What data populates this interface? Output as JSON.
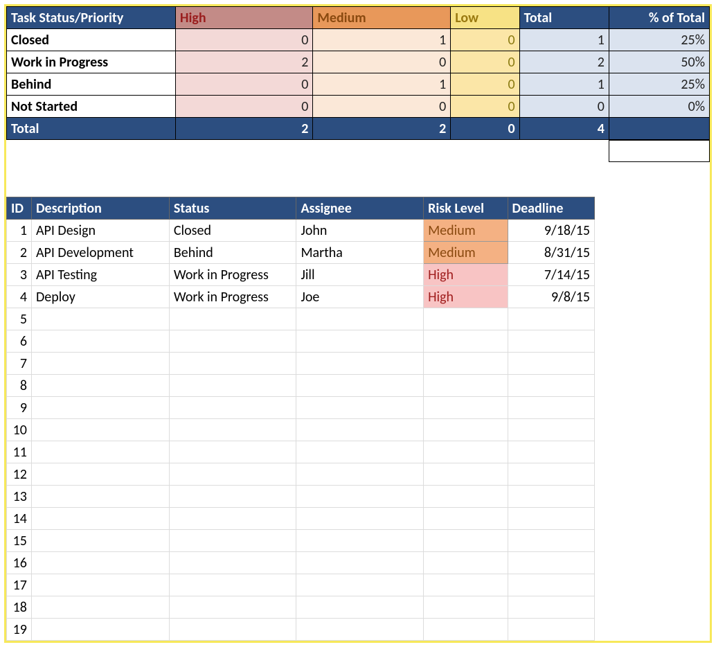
{
  "summary": {
    "headers": {
      "status": "Task Status/Priority",
      "high": "High",
      "medium": "Medium",
      "low": "Low",
      "total": "Total",
      "pct": "% of Total"
    },
    "rows": [
      {
        "status": "Closed",
        "high": "0",
        "medium": "1",
        "low": "0",
        "total": "1",
        "pct": "25%"
      },
      {
        "status": "Work in Progress",
        "high": "2",
        "medium": "0",
        "low": "0",
        "total": "2",
        "pct": "50%"
      },
      {
        "status": "Behind",
        "high": "0",
        "medium": "1",
        "low": "0",
        "total": "1",
        "pct": "25%"
      },
      {
        "status": "Not Started",
        "high": "0",
        "medium": "0",
        "low": "0",
        "total": "0",
        "pct": "0%"
      }
    ],
    "totals": {
      "label": "Total",
      "high": "2",
      "medium": "2",
      "low": "0",
      "total": "4",
      "pct": ""
    }
  },
  "tasks": {
    "headers": {
      "id": "ID",
      "desc": "Description",
      "status": "Status",
      "assignee": "Assignee",
      "risk": "Risk Level",
      "deadline": "Deadline"
    },
    "rows": [
      {
        "id": "1",
        "desc": "API Design",
        "status": "Closed",
        "assignee": "John",
        "risk": "Medium",
        "risk_class": "risk-med",
        "deadline": "9/18/15"
      },
      {
        "id": "2",
        "desc": "API Development",
        "status": "Behind",
        "assignee": "Martha",
        "risk": "Medium",
        "risk_class": "risk-med",
        "deadline": "8/31/15"
      },
      {
        "id": "3",
        "desc": "API Testing",
        "status": "Work in Progress",
        "assignee": "Jill",
        "risk": "High",
        "risk_class": "risk-high",
        "deadline": "7/14/15"
      },
      {
        "id": "4",
        "desc": "Deploy",
        "status": "Work in Progress",
        "assignee": "Joe",
        "risk": "High",
        "risk_class": "risk-high",
        "deadline": "9/8/15"
      }
    ],
    "empty_ids": [
      "5",
      "6",
      "7",
      "8",
      "9",
      "10",
      "11",
      "12",
      "13",
      "14",
      "15",
      "16",
      "17",
      "18",
      "19"
    ]
  }
}
